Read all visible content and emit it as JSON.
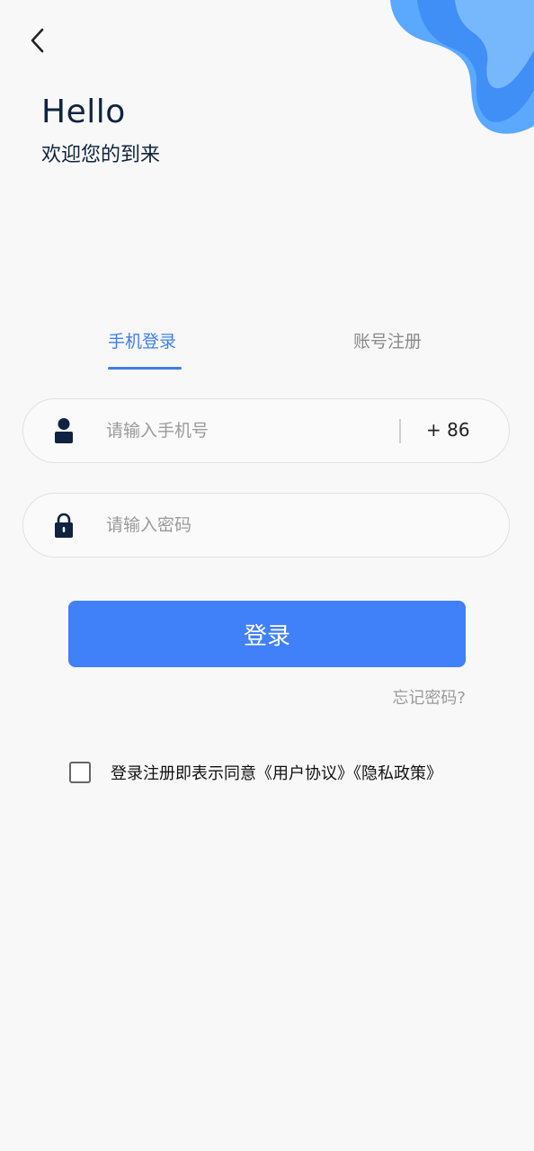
{
  "header": {
    "greeting": "Hello",
    "welcome": "欢迎您的到来"
  },
  "tabs": [
    {
      "label": "手机登录",
      "active": true
    },
    {
      "label": "账号注册",
      "active": false
    }
  ],
  "phone_field": {
    "placeholder": "请输入手机号",
    "value": "",
    "country_code": "+ 86"
  },
  "password_field": {
    "placeholder": "请输入密码",
    "value": ""
  },
  "login_button": {
    "label": "登录"
  },
  "forgot_password": "忘记密码?",
  "agreement": {
    "checked": false,
    "prefix": "登录注册即表示同意",
    "user_agreement": "《用户协议》",
    "privacy_policy": "《隐私政策》"
  },
  "colors": {
    "accent": "#4080f8",
    "tab_active": "#3f7ee8",
    "heading": "#0f2340",
    "background": "#f8f8f8"
  },
  "icons": {
    "back": "chevron-left-icon",
    "user": "user-icon",
    "lock": "lock-icon",
    "decoration": "blue-wave-decoration"
  }
}
